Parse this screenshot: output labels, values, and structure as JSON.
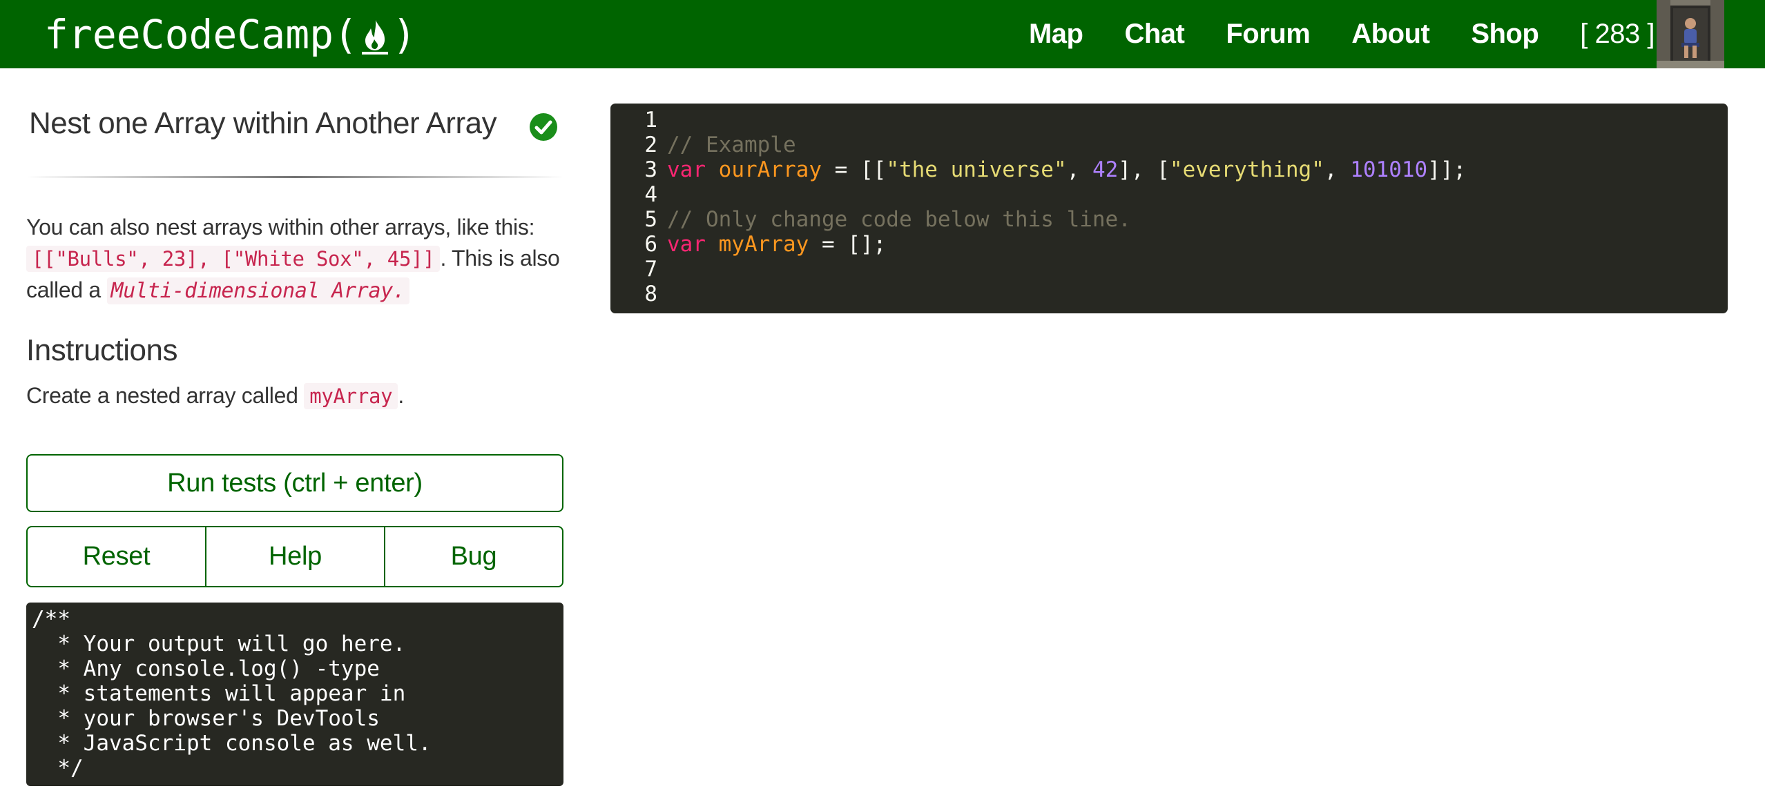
{
  "navbar": {
    "brand_text": "freeCodeCamp",
    "brand_open": "(",
    "brand_close": ")",
    "brand_icon": "flame-icon",
    "links": [
      "Map",
      "Chat",
      "Forum",
      "About",
      "Shop"
    ],
    "points": "[ 283 ]",
    "avatar": "user-avatar-photo",
    "color": "#006400"
  },
  "challenge": {
    "title": "Nest one Array within Another Array",
    "completed_icon": "check-circle-icon",
    "desc_part1": "You can also nest arrays within other arrays, like this:",
    "desc_code": "[[\"Bulls\", 23], [\"White Sox\", 45]]",
    "desc_part2": ". This is also called a ",
    "desc_term": "Multi-dimensional Array.",
    "instructions_heading": "Instructions",
    "instructions_part1": "Create a nested array called ",
    "instructions_code": "myArray",
    "instructions_part2": "."
  },
  "buttons": {
    "run": "Run tests (ctrl + enter)",
    "reset": "Reset",
    "help": "Help",
    "bug": "Bug"
  },
  "output": {
    "text": "/**\n  * Your output will go here.\n  * Any console.log() -type\n  * statements will appear in\n  * your browser's DevTools\n  * JavaScript console as well.\n  */"
  },
  "editor": {
    "lines": [
      {
        "n": "1",
        "tokens": []
      },
      {
        "n": "2",
        "tokens": [
          {
            "t": "comment",
            "v": "// Example"
          }
        ]
      },
      {
        "n": "3",
        "tokens": [
          {
            "t": "keyword",
            "v": "var"
          },
          {
            "t": "punct",
            "v": " "
          },
          {
            "t": "def",
            "v": "ourArray"
          },
          {
            "t": "punct",
            "v": " = [["
          },
          {
            "t": "string",
            "v": "\"the universe\""
          },
          {
            "t": "punct",
            "v": ", "
          },
          {
            "t": "number",
            "v": "42"
          },
          {
            "t": "punct",
            "v": "], ["
          },
          {
            "t": "string",
            "v": "\"everything\""
          },
          {
            "t": "punct",
            "v": ", "
          },
          {
            "t": "number",
            "v": "101010"
          },
          {
            "t": "punct",
            "v": "]];"
          }
        ]
      },
      {
        "n": "4",
        "tokens": []
      },
      {
        "n": "5",
        "tokens": [
          {
            "t": "comment",
            "v": "// Only change code below this line."
          }
        ]
      },
      {
        "n": "6",
        "tokens": [
          {
            "t": "keyword",
            "v": "var"
          },
          {
            "t": "punct",
            "v": " "
          },
          {
            "t": "def",
            "v": "myArray"
          },
          {
            "t": "punct",
            "v": " = [];"
          }
        ]
      },
      {
        "n": "7",
        "tokens": []
      },
      {
        "n": "8",
        "tokens": []
      }
    ],
    "theme_colors": {
      "background": "#272822",
      "comment": "#75715e",
      "keyword": "#f92672",
      "def": "#fd971f",
      "string": "#e6db74",
      "number": "#ae81ff"
    }
  }
}
